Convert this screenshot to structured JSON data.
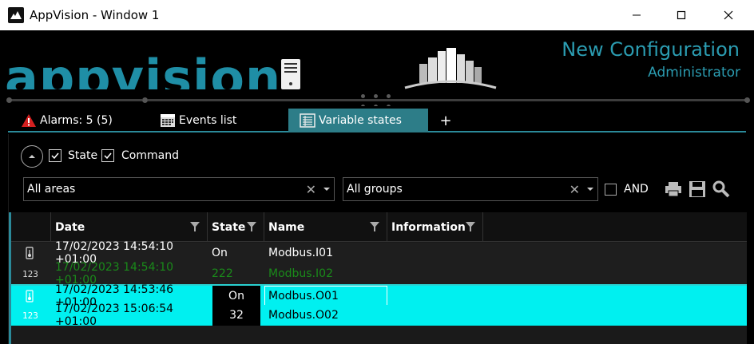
{
  "window": {
    "title": "AppVision - Window 1"
  },
  "header": {
    "logo_text": "appvision",
    "config_title": "New Configuration",
    "user_role": "Administrator"
  },
  "tabs": [
    {
      "label": "Alarms: 5 (5)",
      "icon": "warning-icon",
      "active": false
    },
    {
      "label": "Events list",
      "icon": "calendar-icon",
      "active": false
    },
    {
      "label": "Variable states",
      "icon": "list-icon",
      "active": true
    },
    {
      "label": "+",
      "icon": "",
      "active": false
    }
  ],
  "filters": {
    "state_label": "State",
    "state_checked": true,
    "command_label": "Command",
    "command_checked": true,
    "areas_value": "All areas",
    "groups_value": "All groups",
    "and_label": "AND",
    "and_checked": false
  },
  "grid": {
    "columns": [
      "Date",
      "State",
      "Name",
      "Information"
    ],
    "rows": [
      {
        "icon": "thermometer-icon",
        "date": "17/02/2023 14:54:10 +01:00",
        "state": "On",
        "name": "Modbus.I01",
        "information": "",
        "selected": false,
        "color": "#ffffff"
      },
      {
        "icon": "numeric-icon",
        "date": "17/02/2023 14:54:10 +01:00",
        "state": "222",
        "name": "Modbus.I02",
        "information": "",
        "selected": false,
        "color": "#1a8a1a"
      },
      {
        "icon": "thermometer-icon",
        "date": "17/02/2023 14:53:46 +01:00",
        "state": "On",
        "name": "Modbus.O01",
        "information": "",
        "selected": true,
        "color": "#000000"
      },
      {
        "icon": "numeric-icon",
        "date": "17/02/2023 15:06:54 +01:00",
        "state": "32",
        "name": "Modbus.O02",
        "information": "",
        "selected": true,
        "color": "#000000"
      }
    ]
  },
  "colors": {
    "accent": "#2b9cb1",
    "active_tab": "#2d7d88",
    "selection": "#00f0f0"
  }
}
